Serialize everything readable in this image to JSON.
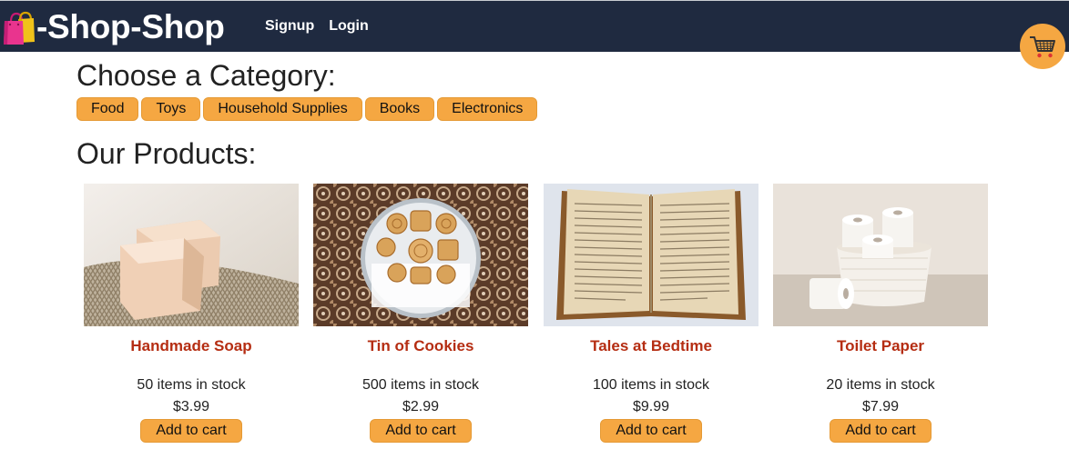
{
  "header": {
    "brand_emoji_icon": "shopping-bags-icon",
    "brand_title": "-Shop-Shop",
    "nav": [
      {
        "label": "Signup"
      },
      {
        "label": "Login"
      }
    ],
    "cart_icon": "shopping-cart-icon"
  },
  "categories": {
    "title": "Choose a Category:",
    "items": [
      {
        "label": "Food"
      },
      {
        "label": "Toys"
      },
      {
        "label": "Household Supplies"
      },
      {
        "label": "Books"
      },
      {
        "label": "Electronics"
      }
    ]
  },
  "products": {
    "title": "Our Products:",
    "add_label": "Add to cart",
    "items": [
      {
        "name": "Handmade Soap",
        "stock": "50 items in stock",
        "price": "$3.99",
        "image": "soap-image"
      },
      {
        "name": "Tin of Cookies",
        "stock": "500 items in stock",
        "price": "$2.99",
        "image": "cookies-image"
      },
      {
        "name": "Tales at Bedtime",
        "stock": "100 items in stock",
        "price": "$9.99",
        "image": "book-image"
      },
      {
        "name": "Toilet Paper",
        "stock": "20 items in stock",
        "price": "$7.99",
        "image": "toilet-paper-image"
      }
    ]
  },
  "colors": {
    "navbar": "#1f2a40",
    "accent": "#f5a742",
    "product_name": "#b52d12"
  }
}
